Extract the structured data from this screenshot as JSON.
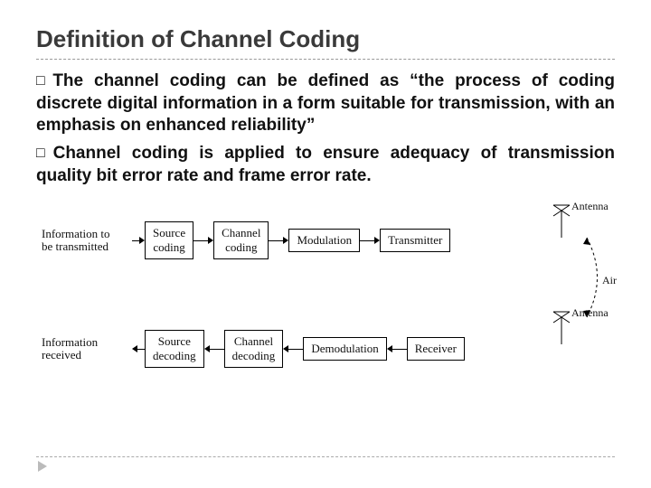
{
  "title": "Definition of Channel Coding",
  "bullet_marker": "□",
  "bullets": [
    {
      "lead": "The",
      "rest": " channel coding can be defined as “the process of coding discrete digital information in a form suitable for transmission, with an emphasis on enhanced reliability”"
    },
    {
      "lead": "Channel",
      "rest": " coding is applied to ensure adequacy of transmission quality bit error rate and frame error rate."
    }
  ],
  "diagram": {
    "tx_info_l1": "Information to",
    "tx_info_l2": "be transmitted",
    "rx_info_l1": "Information",
    "rx_info_l2": "received",
    "boxes": {
      "src_coding": "Source\ncoding",
      "ch_coding": "Channel\ncoding",
      "modulation": "Modulation",
      "transmitter": "Transmitter",
      "src_decoding": "Source\ndecoding",
      "ch_decoding": "Channel\ndecoding",
      "demodulation": "Demodulation",
      "receiver": "Receiver"
    },
    "antenna_label": "Antenna",
    "air_label": "Air"
  }
}
